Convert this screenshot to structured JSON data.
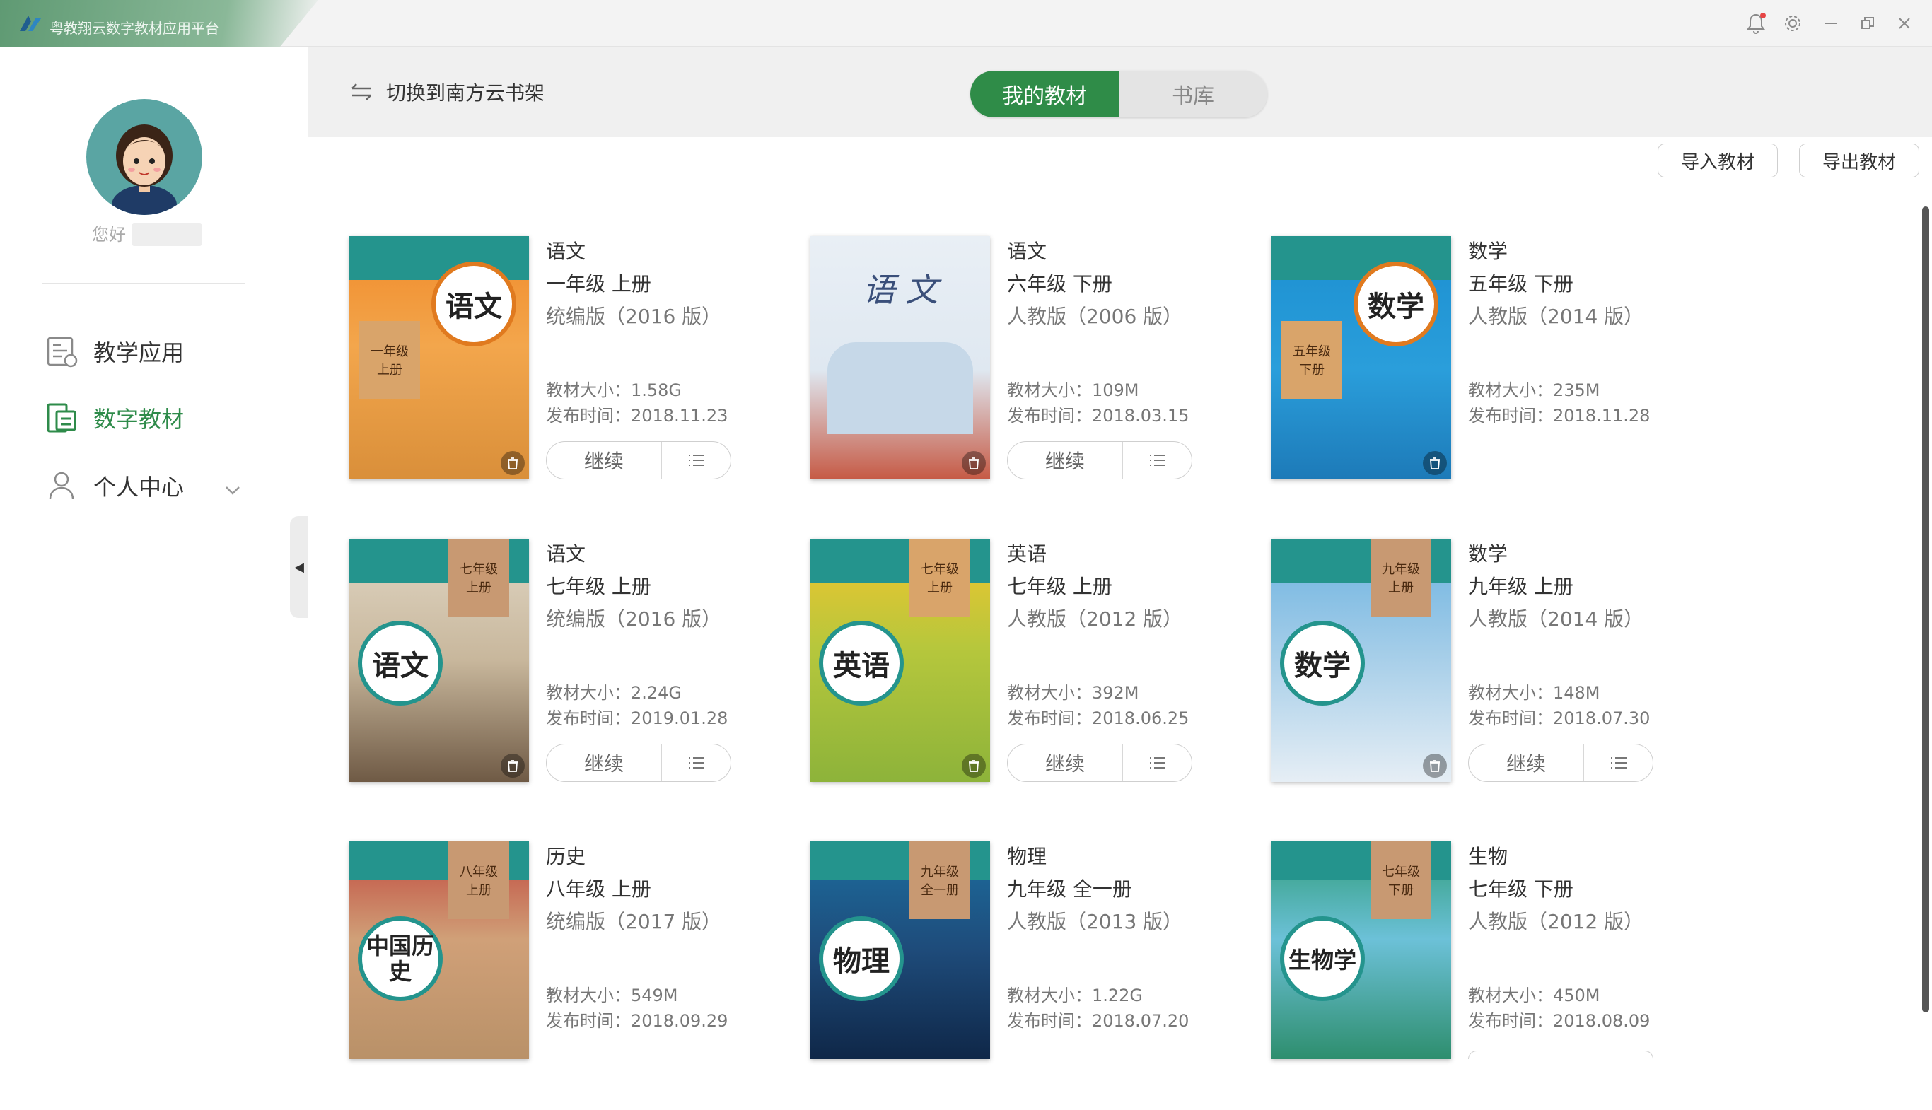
{
  "app": {
    "title": "粤教翔云数字教材应用平台"
  },
  "user": {
    "greeting": "您好"
  },
  "nav": [
    {
      "label": "教学应用",
      "icon": "teaching-app-icon"
    },
    {
      "label": "数字教材",
      "icon": "digital-textbook-icon",
      "active": true
    },
    {
      "label": "个人中心",
      "icon": "person-icon"
    }
  ],
  "toolbar": {
    "switch_label": "切换到南方云书架"
  },
  "tabs": {
    "mine": "我的教材",
    "library": "书库"
  },
  "actions": {
    "import": "导入教材",
    "export": "导出教材"
  },
  "continue_label": "继续",
  "colors": {
    "accent": "#2f8c48"
  },
  "books": [
    {
      "subject": "语文",
      "grade": "一年级  上册",
      "edition": "统编版（2016 版）",
      "size": "教材大小：1.58G",
      "date": "发布时间：2018.11.23",
      "cover_title": "语文",
      "cover_grade": "一年级",
      "cover_vol": "上册"
    },
    {
      "subject": "语文",
      "grade": "六年级  下册",
      "edition": "人教版（2006 版）",
      "size": "教材大小：109M",
      "date": "发布时间：2018.03.15",
      "cover_title": "语 文",
      "cover_grade": "",
      "cover_vol": ""
    },
    {
      "subject": "数学",
      "grade": "五年级  下册",
      "edition": "人教版（2014 版）",
      "size": "教材大小：235M",
      "date": "发布时间：2018.11.28",
      "cover_title": "数学",
      "cover_grade": "五年级",
      "cover_vol": "下册"
    },
    {
      "subject": "语文",
      "grade": "七年级  上册",
      "edition": "统编版（2016 版）",
      "size": "教材大小：2.24G",
      "date": "发布时间：2019.01.28",
      "cover_title": "语文",
      "cover_grade": "七年级",
      "cover_vol": "上册"
    },
    {
      "subject": "英语",
      "grade": "七年级  上册",
      "edition": "人教版（2012 版）",
      "size": "教材大小：392M",
      "date": "发布时间：2018.06.25",
      "cover_title": "英语",
      "cover_grade": "七年级",
      "cover_vol": "上册"
    },
    {
      "subject": "数学",
      "grade": "九年级  上册",
      "edition": "人教版（2014 版）",
      "size": "教材大小：148M",
      "date": "发布时间：2018.07.30",
      "cover_title": "数学",
      "cover_grade": "九年级",
      "cover_vol": "上册"
    },
    {
      "subject": "历史",
      "grade": "八年级  上册",
      "edition": "统编版（2017 版）",
      "size": "教材大小：549M",
      "date": "发布时间：2018.09.29",
      "cover_title": "中国历史",
      "cover_grade": "八年级",
      "cover_vol": "上册"
    },
    {
      "subject": "物理",
      "grade": "九年级  全一册",
      "edition": "人教版（2013 版）",
      "size": "教材大小：1.22G",
      "date": "发布时间：2018.07.20",
      "cover_title": "物理",
      "cover_grade": "九年级",
      "cover_vol": "全一册"
    },
    {
      "subject": "生物",
      "grade": "七年级  下册",
      "edition": "人教版（2012 版）",
      "size": "教材大小：450M",
      "date": "发布时间：2018.08.09",
      "cover_title": "生物学",
      "cover_grade": "七年级",
      "cover_vol": "下册"
    }
  ]
}
